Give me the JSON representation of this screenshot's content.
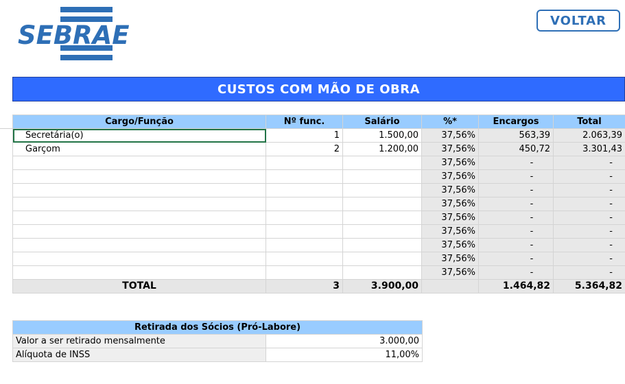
{
  "header": {
    "logo_text": "SEBRAE",
    "back_button": "VOLTAR"
  },
  "banner": {
    "title": "CUSTOS COM MÃO DE OBRA"
  },
  "labor_table": {
    "columns": [
      "Cargo/Função",
      "Nº func.",
      "Salário",
      "%*",
      "Encargos",
      "Total"
    ],
    "rows": [
      {
        "cargo": "Secretária(o)",
        "func": "1",
        "salario": "1.500,00",
        "pct": "37,56%",
        "encargos": "563,39",
        "total": "2.063,39"
      },
      {
        "cargo": "Garçom",
        "func": "2",
        "salario": "1.200,00",
        "pct": "37,56%",
        "encargos": "450,72",
        "total": "3.301,43"
      },
      {
        "cargo": "",
        "func": "",
        "salario": "",
        "pct": "37,56%",
        "encargos": "-",
        "total": "-"
      },
      {
        "cargo": "",
        "func": "",
        "salario": "",
        "pct": "37,56%",
        "encargos": "-",
        "total": "-"
      },
      {
        "cargo": "",
        "func": "",
        "salario": "",
        "pct": "37,56%",
        "encargos": "-",
        "total": "-"
      },
      {
        "cargo": "",
        "func": "",
        "salario": "",
        "pct": "37,56%",
        "encargos": "-",
        "total": "-"
      },
      {
        "cargo": "",
        "func": "",
        "salario": "",
        "pct": "37,56%",
        "encargos": "-",
        "total": "-"
      },
      {
        "cargo": "",
        "func": "",
        "salario": "",
        "pct": "37,56%",
        "encargos": "-",
        "total": "-"
      },
      {
        "cargo": "",
        "func": "",
        "salario": "",
        "pct": "37,56%",
        "encargos": "-",
        "total": "-"
      },
      {
        "cargo": "",
        "func": "",
        "salario": "",
        "pct": "37,56%",
        "encargos": "-",
        "total": "-"
      },
      {
        "cargo": "",
        "func": "",
        "salario": "",
        "pct": "37,56%",
        "encargos": "-",
        "total": "-"
      }
    ],
    "total_row": {
      "label": "TOTAL",
      "func": "3",
      "salario": "3.900,00",
      "pct": "",
      "encargos": "1.464,82",
      "total": "5.364,82"
    }
  },
  "prolabore": {
    "title": "Retirada dos Sócios (Pró-Labore)",
    "rows": [
      {
        "label": "Valor a ser retirado mensalmente",
        "value": "3.000,00"
      },
      {
        "label": "Alíquota de INSS",
        "value": "11,00%"
      }
    ]
  },
  "colors": {
    "brand": "#2e6fb6",
    "banner": "#2f6bff",
    "header_fill": "#99ccff",
    "selection": "#217346"
  }
}
